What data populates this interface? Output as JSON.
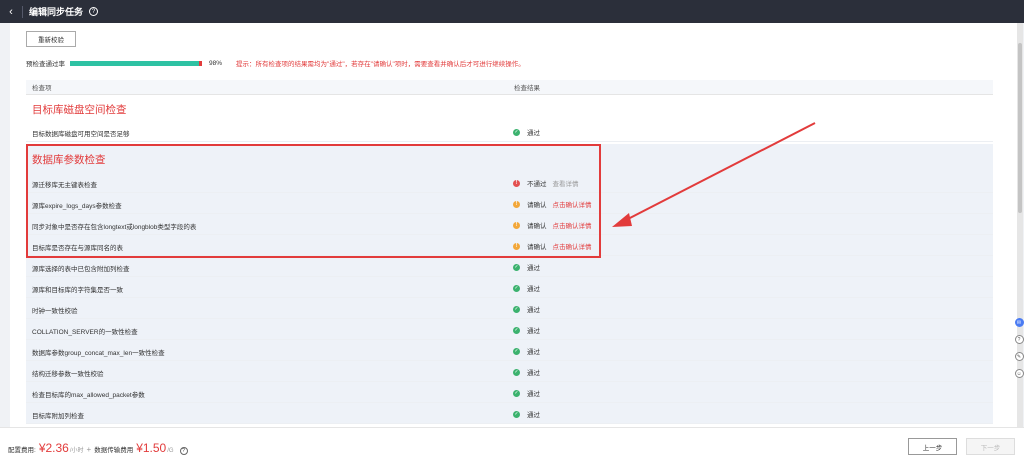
{
  "header": {
    "title": "编辑同步任务",
    "back_icon": "chevron-left-icon",
    "help_icon": "question-circle-icon"
  },
  "toolbar": {
    "recheck_label": "重新校验"
  },
  "progress": {
    "label": "预检查通过率",
    "percent": 98,
    "percent_text": "98%",
    "tip": "提示：所有检查项的结果需均为\"通过\"，若存在\"请确认\"项时，需要查看并确认后才可进行继续操作。"
  },
  "table": {
    "col_item": "检查项",
    "col_result": "检查结果"
  },
  "groups": [
    {
      "title": "目标库磁盘空间检查",
      "rows": [
        {
          "name": "目标数据库磁盘可用空间是否足够",
          "status": "pass",
          "status_text": "通过",
          "link": ""
        }
      ]
    },
    {
      "title": "数据库参数检查",
      "rows": [
        {
          "name": "源迁移库无主键表检查",
          "status": "fail",
          "status_text": "不通过",
          "link": "查看详情"
        },
        {
          "name": "源库expire_logs_days参数检查",
          "status": "warn",
          "status_text": "请确认",
          "link": "点击确认详情"
        },
        {
          "name": "同步对象中是否存在包含longtext或longblob类型字段的表",
          "status": "warn",
          "status_text": "请确认",
          "link": "点击确认详情"
        },
        {
          "name": "目标库是否存在与源库同名的表",
          "status": "warn",
          "status_text": "请确认",
          "link": "点击确认详情"
        },
        {
          "name": "源库选择的表中已包含附加列检查",
          "status": "pass",
          "status_text": "通过",
          "link": ""
        },
        {
          "name": "源库和目标库的字符集是否一致",
          "status": "pass",
          "status_text": "通过",
          "link": ""
        },
        {
          "name": "时钟一致性校验",
          "status": "pass",
          "status_text": "通过",
          "link": ""
        },
        {
          "name": "COLLATION_SERVER的一致性检查",
          "status": "pass",
          "status_text": "通过",
          "link": ""
        },
        {
          "name": "数据库参数group_concat_max_len一致性检查",
          "status": "pass",
          "status_text": "通过",
          "link": ""
        },
        {
          "name": "结构迁移参数一致性校验",
          "status": "pass",
          "status_text": "通过",
          "link": ""
        },
        {
          "name": "检查目标库的max_allowed_packet参数",
          "status": "pass",
          "status_text": "通过",
          "link": ""
        },
        {
          "name": "目标库附加列检查",
          "status": "pass",
          "status_text": "通过",
          "link": ""
        }
      ]
    }
  ],
  "footer": {
    "config_fee_label": "配置费用:",
    "config_fee_price": "¥2.36",
    "config_fee_unit": "/小时",
    "plus": "+",
    "transfer_fee_label": "数据传输费用",
    "transfer_fee_price": "¥1.50",
    "transfer_fee_unit": "/G",
    "prev_label": "上一步",
    "next_label": "下一步"
  },
  "colors": {
    "accent_red": "#e23b3b",
    "pass_green": "#3bb26e",
    "warn_orange": "#f2a73a",
    "progress_teal": "#2ec2a3",
    "topbar_bg": "#2b2f3a"
  }
}
